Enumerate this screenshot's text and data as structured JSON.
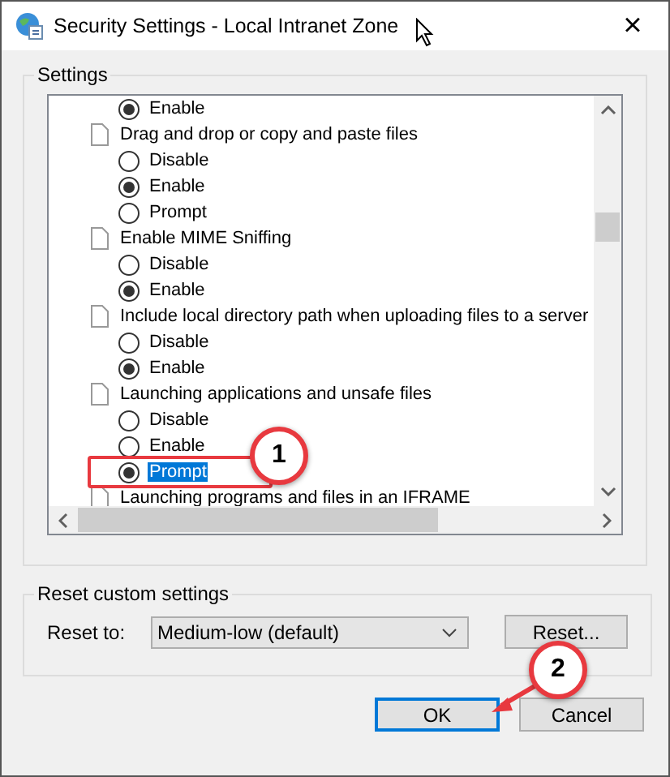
{
  "window": {
    "title": "Security Settings - Local Intranet Zone",
    "close": "×"
  },
  "settings": {
    "label": "Settings",
    "items": [
      {
        "kind": "option",
        "label": "Enable",
        "selected": true,
        "highlighted": false
      },
      {
        "kind": "setting",
        "label": "Drag and drop or copy and paste files"
      },
      {
        "kind": "option",
        "label": "Disable",
        "selected": false,
        "highlighted": false
      },
      {
        "kind": "option",
        "label": "Enable",
        "selected": true,
        "highlighted": false
      },
      {
        "kind": "option",
        "label": "Prompt",
        "selected": false,
        "highlighted": false
      },
      {
        "kind": "setting",
        "label": "Enable MIME Sniffing"
      },
      {
        "kind": "option",
        "label": "Disable",
        "selected": false,
        "highlighted": false
      },
      {
        "kind": "option",
        "label": "Enable",
        "selected": true,
        "highlighted": false
      },
      {
        "kind": "setting",
        "label": "Include local directory path when uploading files to a server"
      },
      {
        "kind": "option",
        "label": "Disable",
        "selected": false,
        "highlighted": false
      },
      {
        "kind": "option",
        "label": "Enable",
        "selected": true,
        "highlighted": false
      },
      {
        "kind": "setting",
        "label": "Launching applications and unsafe files"
      },
      {
        "kind": "option",
        "label": "Disable",
        "selected": false,
        "highlighted": false
      },
      {
        "kind": "option",
        "label": "Enable",
        "selected": false,
        "highlighted": false
      },
      {
        "kind": "option",
        "label": "Prompt",
        "selected": true,
        "highlighted": true
      },
      {
        "kind": "setting",
        "label": "Launching programs and files in an IFRAME"
      }
    ]
  },
  "reset": {
    "label": "Reset custom settings",
    "reset_to_label": "Reset to:",
    "dropdown_value": "Medium-low (default)",
    "reset_button": "Reset..."
  },
  "buttons": [
    {
      "label": "OK",
      "default": true
    },
    {
      "label": "Cancel",
      "default": false
    }
  ],
  "callouts": [
    {
      "number": "1"
    },
    {
      "number": "2"
    }
  ]
}
